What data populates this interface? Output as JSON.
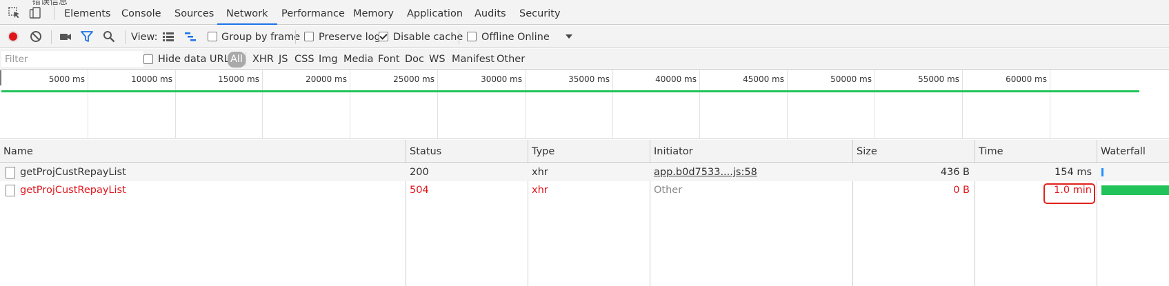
{
  "devtools": {
    "stray_text": "错误信息",
    "tabs": [
      {
        "label": "Elements"
      },
      {
        "label": "Console"
      },
      {
        "label": "Sources"
      },
      {
        "label": "Network",
        "active": true
      },
      {
        "label": "Performance"
      },
      {
        "label": "Memory"
      },
      {
        "label": "Application"
      },
      {
        "label": "Audits"
      },
      {
        "label": "Security"
      }
    ]
  },
  "toolbar": {
    "view_label": "View:",
    "group_by_frame": {
      "label": "Group by frame",
      "checked": false
    },
    "preserve_log": {
      "label": "Preserve log",
      "checked": false
    },
    "disable_cache": {
      "label": "Disable cache",
      "checked": true
    },
    "offline": {
      "label": "Offline",
      "checked": false
    },
    "throttle_value": "Online"
  },
  "filter": {
    "placeholder": "Filter",
    "hide_data_urls": {
      "label": "Hide data URLs",
      "checked": false
    },
    "types": [
      "All",
      "XHR",
      "JS",
      "CSS",
      "Img",
      "Media",
      "Font",
      "Doc",
      "WS",
      "Manifest",
      "Other"
    ],
    "active_type": "All"
  },
  "overview": {
    "ticks": [
      "5000 ms",
      "10000 ms",
      "15000 ms",
      "20000 ms",
      "25000 ms",
      "30000 ms",
      "35000 ms",
      "40000 ms",
      "45000 ms",
      "50000 ms",
      "55000 ms",
      "60000 ms"
    ]
  },
  "table": {
    "columns": [
      "Name",
      "Status",
      "Type",
      "Initiator",
      "Size",
      "Time",
      "Waterfall"
    ],
    "rows": [
      {
        "name": "getProjCustRepayList",
        "status": "200",
        "type": "xhr",
        "initiator": "app.b0d7533....js:58",
        "size": "436 B",
        "time": "154 ms",
        "error": false,
        "waterfall_fraction": 0.0026
      },
      {
        "name": "getProjCustRepayList",
        "status": "504",
        "type": "xhr",
        "initiator": "Other",
        "size": "0 B",
        "time": "1.0 min",
        "error": true,
        "waterfall_fraction": 1.0
      }
    ]
  },
  "colors": {
    "accent": "#1a73e8",
    "record": "#e0151a",
    "error_text": "#e0151a",
    "highlight": "#e2211c",
    "timeline_green": "#21c35a",
    "waterfall_blue": "#1e90ff"
  }
}
